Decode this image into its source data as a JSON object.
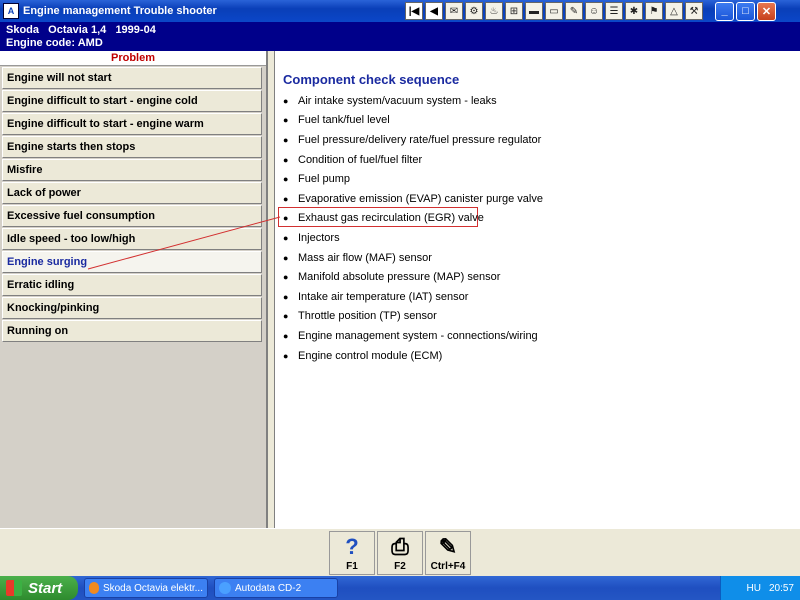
{
  "window": {
    "title": "Engine management Trouble shooter",
    "toolbar_icons": [
      "first-page-icon",
      "previous-page-icon",
      "tool-icon",
      "tool-icon",
      "tool-icon",
      "tool-icon",
      "tool-icon",
      "tool-icon",
      "tool-icon",
      "tool-icon",
      "tool-icon",
      "tool-icon",
      "tool-icon",
      "tool-icon",
      "tool-icon"
    ],
    "controls": {
      "minimize": "_",
      "maximize": "□",
      "close": "✕"
    }
  },
  "vehicle": {
    "line1": "Skoda   Octavia 1,4   1999-04",
    "line2": "Engine code: AMD"
  },
  "sidebar": {
    "header": "Problem",
    "items": [
      {
        "label": "Engine will not start"
      },
      {
        "label": "Engine difficult to start - engine cold"
      },
      {
        "label": "Engine difficult to start - engine warm"
      },
      {
        "label": "Engine starts then stops"
      },
      {
        "label": "Misfire"
      },
      {
        "label": "Lack of power"
      },
      {
        "label": "Excessive fuel consumption"
      },
      {
        "label": "Idle speed - too low/high"
      },
      {
        "label": "Engine surging"
      },
      {
        "label": "Erratic idling"
      },
      {
        "label": "Knocking/pinking"
      },
      {
        "label": "Running on"
      }
    ],
    "selected": "Engine surging"
  },
  "main": {
    "title": "Component check sequence",
    "items": [
      "Air intake system/vacuum system - leaks",
      "Fuel tank/fuel level",
      "Fuel pressure/delivery rate/fuel pressure regulator",
      "Condition of fuel/fuel filter",
      "Fuel pump",
      "Evaporative emission (EVAP) canister purge valve",
      "Exhaust gas recirculation (EGR) valve",
      "Injectors",
      "Mass air flow (MAF) sensor",
      "Manifold absolute pressure (MAP) sensor",
      "Intake air temperature (IAT) sensor",
      "Throttle position (TP) sensor",
      "Engine management system - connections/wiring",
      "Engine control module (ECM)"
    ],
    "highlighted": "Exhaust gas recirculation (EGR) valve",
    "highlight_color": "#d23030"
  },
  "bottom_buttons": [
    {
      "key": "F1",
      "icon": "help-icon"
    },
    {
      "key": "F2",
      "icon": "print-icon"
    },
    {
      "key": "Ctrl+F4",
      "icon": "notes-icon"
    }
  ],
  "taskbar": {
    "start": "Start",
    "buttons": [
      "Skoda Octavia elektr...",
      "Autodata CD-2"
    ],
    "language": "HU",
    "clock": "20:57"
  }
}
